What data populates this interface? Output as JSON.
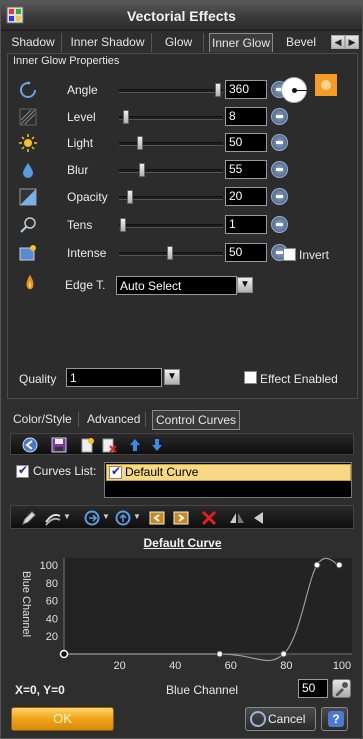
{
  "window": {
    "title": "Vectorial Effects"
  },
  "tabs": [
    "Shadow",
    "Inner Shadow",
    "Glow",
    "Inner Glow",
    "Bevel"
  ],
  "group_title": "Inner Glow Properties",
  "properties": [
    {
      "label": "Angle",
      "value": "360",
      "icon": "angle-icon"
    },
    {
      "label": "Level",
      "value": "8",
      "icon": "level-icon"
    },
    {
      "label": "Light",
      "value": "50",
      "icon": "sun-icon"
    },
    {
      "label": "Blur",
      "value": "55",
      "icon": "drop-icon"
    },
    {
      "label": "Opacity",
      "value": "20",
      "icon": "opacity-icon"
    },
    {
      "label": "Tens",
      "value": "1",
      "icon": "tension-icon"
    },
    {
      "label": "Intense",
      "value": "50",
      "icon": "intense-icon"
    }
  ],
  "invert_label": "Invert",
  "edge": {
    "label": "Edge T.",
    "value": "Auto Select"
  },
  "quality": {
    "label": "Quality",
    "value": "1"
  },
  "effect_enabled_label": "Effect Enabled",
  "lower_tabs": [
    "Color/Style",
    "Advanced",
    "Control Curves"
  ],
  "curves": {
    "list_label": "Curves List:",
    "items": [
      "Default Curve"
    ],
    "title": "Default Curve"
  },
  "chart_data": {
    "type": "line",
    "ylabel": "Blue Channel",
    "xlabel": "Blue Channel",
    "xlim": [
      0,
      100
    ],
    "ylim": [
      0,
      100
    ],
    "xticks": [
      "20",
      "40",
      "60",
      "80",
      "100"
    ],
    "yticks": [
      "20",
      "40",
      "60",
      "80",
      "100"
    ],
    "points": [
      {
        "x": 0,
        "y": 0
      },
      {
        "x": 56,
        "y": 0
      },
      {
        "x": 79,
        "y": 0
      },
      {
        "x": 91,
        "y": 100
      },
      {
        "x": 99,
        "y": 100
      }
    ]
  },
  "coords_readout": "X=0, Y=0",
  "zoom_value": "50",
  "buttons": {
    "ok": "OK",
    "cancel": "Cancel",
    "help": "?"
  },
  "colors": {
    "accent": "#f0a418",
    "selection": "#f7d886"
  }
}
